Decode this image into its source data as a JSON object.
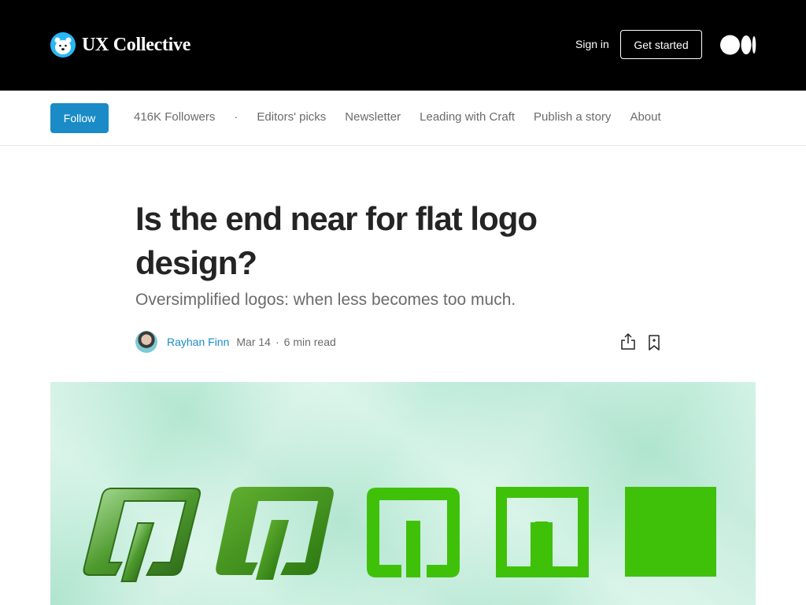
{
  "header": {
    "brand_name": "UX Collective",
    "signin_label": "Sign in",
    "get_started_label": "Get started"
  },
  "pubnav": {
    "follow_label": "Follow",
    "followers": "416K Followers",
    "separator": "·",
    "links": [
      "Editors' picks",
      "Newsletter",
      "Leading with Craft",
      "Publish a story",
      "About"
    ]
  },
  "article": {
    "title": "Is the end near for flat logo design?",
    "subtitle": "Oversimplified logos: when less becomes too much.",
    "author": "Rayhan Finn",
    "date": "Mar 14",
    "dot": "·",
    "read_time": "6 min read"
  },
  "icons": {
    "brand_logo": "polar-bear-logo-icon",
    "medium_logo": "medium-logo-icon",
    "share": "share-icon",
    "bookmark": "bookmark-icon"
  },
  "colors": {
    "topbar_bg": "#000000",
    "accent": "#1a8bc7",
    "hero_bg": "#c2eedb",
    "logo_green": "#3fc10a"
  }
}
